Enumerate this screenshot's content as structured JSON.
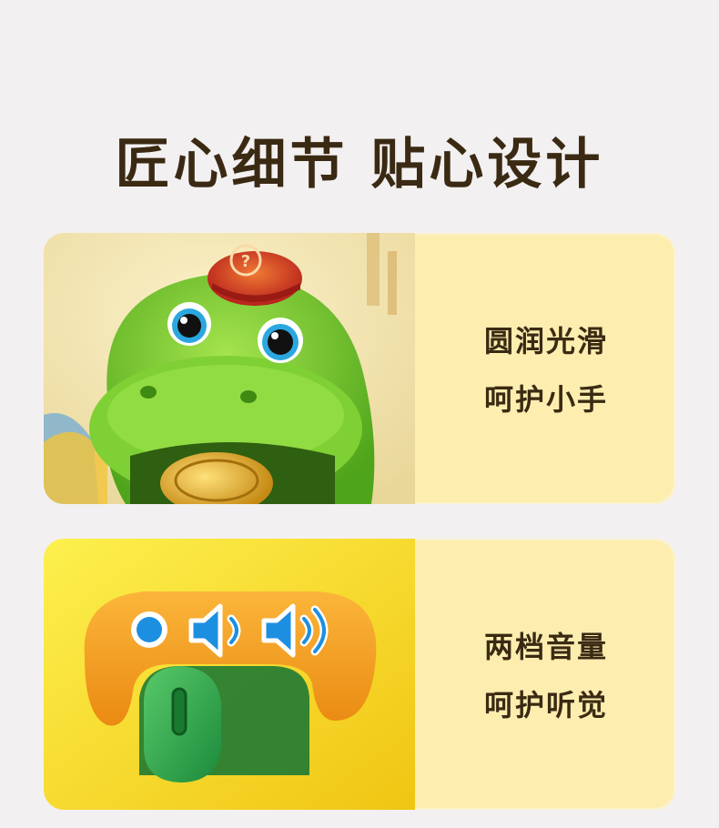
{
  "header": {
    "title": "匠心细节 贴心设计"
  },
  "features": [
    {
      "line1": "圆润光滑",
      "line2": "呵护小手",
      "image": "dinosaur-toy-rounded-mouth"
    },
    {
      "line1": "两档音量",
      "line2": "呵护听觉",
      "image": "volume-switch-two-levels"
    }
  ],
  "colors": {
    "background": "#f3f0f1",
    "card": "#fdeeb0",
    "title_text": "#3b2a13",
    "dino_green": "#6fc42a",
    "switch_orange": "#f7a220",
    "icon_blue": "#1d8fe0"
  }
}
